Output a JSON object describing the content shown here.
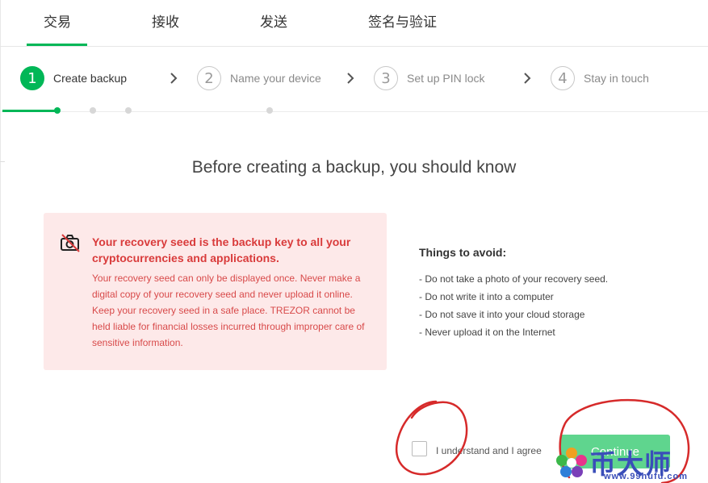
{
  "tabs": [
    {
      "label": "交易",
      "active": true
    },
    {
      "label": "接收",
      "active": false
    },
    {
      "label": "发送",
      "active": false
    },
    {
      "label": "签名与验证",
      "active": false
    }
  ],
  "steps": [
    {
      "num": "1",
      "label": "Create backup",
      "active": true
    },
    {
      "num": "2",
      "label": "Name your device",
      "active": false
    },
    {
      "num": "3",
      "label": "Set up PIN lock",
      "active": false
    },
    {
      "num": "4",
      "label": "Stay in touch",
      "active": false
    }
  ],
  "heading": "Before creating a backup, you should know",
  "warning": {
    "icon": "no-camera-icon",
    "title": "Your recovery seed is the backup key to all your cryptocurrencies and applications.",
    "body": "Your recovery seed can only be displayed once. Never make a digital copy of your recovery seed and never upload it online. Keep your recovery seed in a safe place. TREZOR cannot be held liable for financial losses incurred through improper care of sensitive information."
  },
  "avoid": {
    "title": "Things to avoid:",
    "items": [
      "- Do not take a photo of your recovery seed.",
      "- Do not write it into a computer",
      "- Do not save it into your cloud storage",
      "- Never upload it on the Internet"
    ]
  },
  "agreement": {
    "label": "I understand and I agree",
    "checked": false
  },
  "continue_label": "Continue",
  "watermark": {
    "text": "币大师",
    "url": "www.99hufu.com"
  },
  "colors": {
    "accent": "#01b757",
    "warning_bg": "#fde9e9",
    "warning_text": "#d93b3b",
    "annotation": "#d62a2a",
    "watermark": "#3a4eb9"
  }
}
